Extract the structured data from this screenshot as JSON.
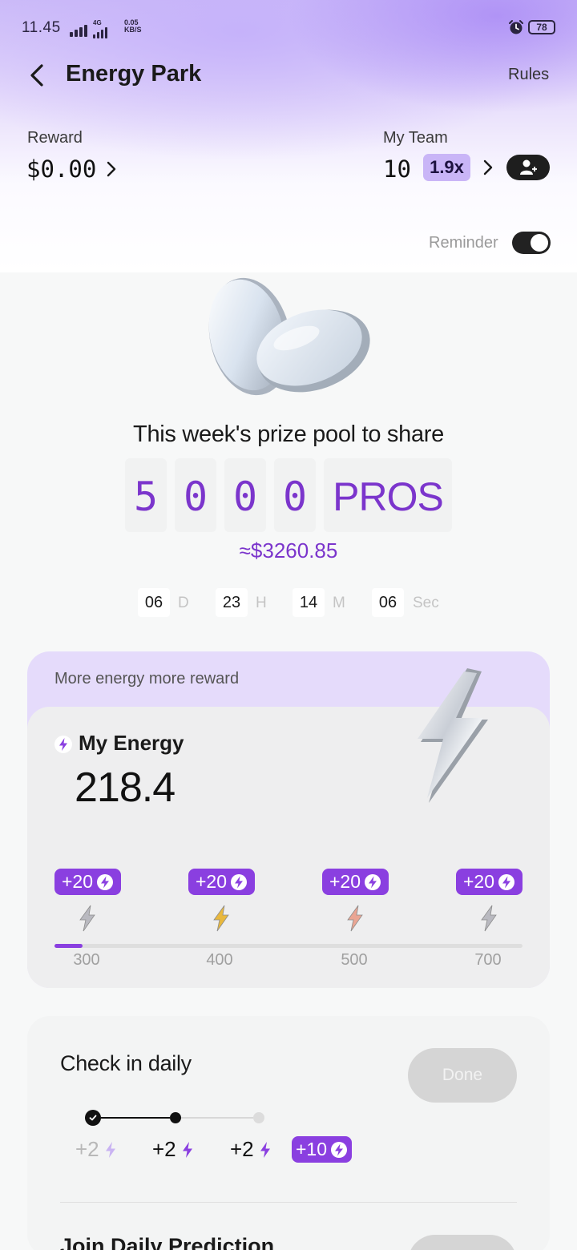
{
  "status_bar": {
    "time": "11.45",
    "network_type": "4G",
    "speed_value": "0.05",
    "speed_unit": "KB/S",
    "battery": "78",
    "icons": [
      "signal-icon",
      "signal-4g-icon",
      "alarm-icon",
      "battery-icon"
    ]
  },
  "header": {
    "title": "Energy Park",
    "rules_label": "Rules"
  },
  "reward": {
    "label": "Reward",
    "value": "$0.00"
  },
  "team": {
    "label": "My Team",
    "value": "10",
    "multiplier": "1.9x"
  },
  "reminder": {
    "label": "Reminder",
    "enabled": true
  },
  "prize_pool": {
    "title": "This week's prize pool to share",
    "digits": [
      "5",
      "0",
      "0",
      "0"
    ],
    "unit": "PROS",
    "usd_value": "≈$3260.85",
    "countdown": {
      "days": "06",
      "days_unit": "D",
      "hours": "23",
      "hours_unit": "H",
      "minutes": "14",
      "minutes_unit": "M",
      "seconds": "06",
      "seconds_unit": "Sec"
    }
  },
  "energy": {
    "hint": "More energy more reward",
    "label": "My Energy",
    "value": "218.4",
    "progress_fraction": 0.06,
    "milestones": [
      {
        "bonus": "+20",
        "threshold": "300",
        "color": "#b9b9c0"
      },
      {
        "bonus": "+20",
        "threshold": "400",
        "color": "#e9b83d"
      },
      {
        "bonus": "+20",
        "threshold": "500",
        "color": "#eaa593"
      },
      {
        "bonus": "+20",
        "threshold": "700",
        "color": "#b9b9c0"
      }
    ]
  },
  "checkin": {
    "title": "Check in daily",
    "button_label": "Done",
    "steps": [
      {
        "reward": "+2",
        "state": "claimed"
      },
      {
        "reward": "+2",
        "state": "current"
      },
      {
        "reward": "+2",
        "state": "upcoming"
      }
    ],
    "bonus": "+10"
  },
  "prediction": {
    "title": "Join Daily Prediction"
  },
  "colors": {
    "accent": "#8a3fe0",
    "pool_text": "#7b35cc",
    "badge_bg": "#c9b5f7"
  }
}
